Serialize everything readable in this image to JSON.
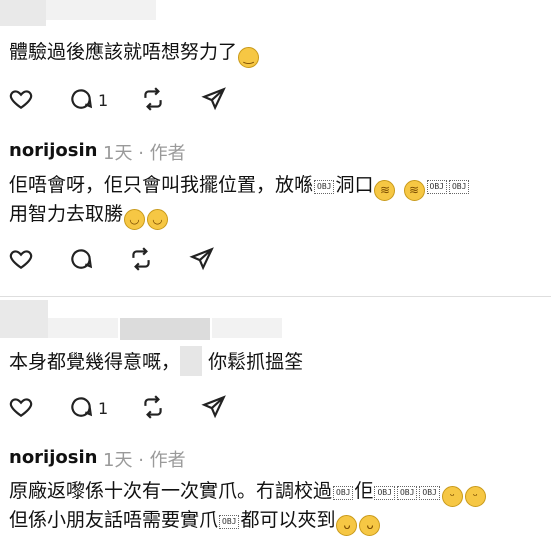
{
  "comments": [
    {
      "text": "體驗過後應該就唔想努力了",
      "emoji": "😌",
      "replies_count": "1"
    },
    {
      "username": "norijosin",
      "time": "1天",
      "separator": "·",
      "role": "作者",
      "line1_a": "佢唔會呀，佢只會叫我擺位置，放喺",
      "line1_b": "洞口",
      "line2": "用智力去取勝"
    },
    {
      "text_a": "本身都覺幾得意嘅，",
      "text_b": "你鬆抓搵筌",
      "replies_count": "1"
    },
    {
      "username": "norijosin",
      "time": "1天",
      "separator": "·",
      "role": "作者",
      "line1_a": "原廠返嚟係十次有一次實爪。冇調校過",
      "line1_b": "佢",
      "line2_a": "但係小朋友話唔需要實爪",
      "line2_b": "都可以夾到"
    }
  ],
  "icons": {
    "like": "heart-icon",
    "reply": "comment-icon",
    "repost": "repost-icon",
    "share": "send-icon",
    "laugh_emoji": "rofl-emoji",
    "smile_emoji": "smile-emoji",
    "tear_emoji": "joy-emoji",
    "yum_emoji": "yum-emoji"
  },
  "obj_token": "OBJ"
}
